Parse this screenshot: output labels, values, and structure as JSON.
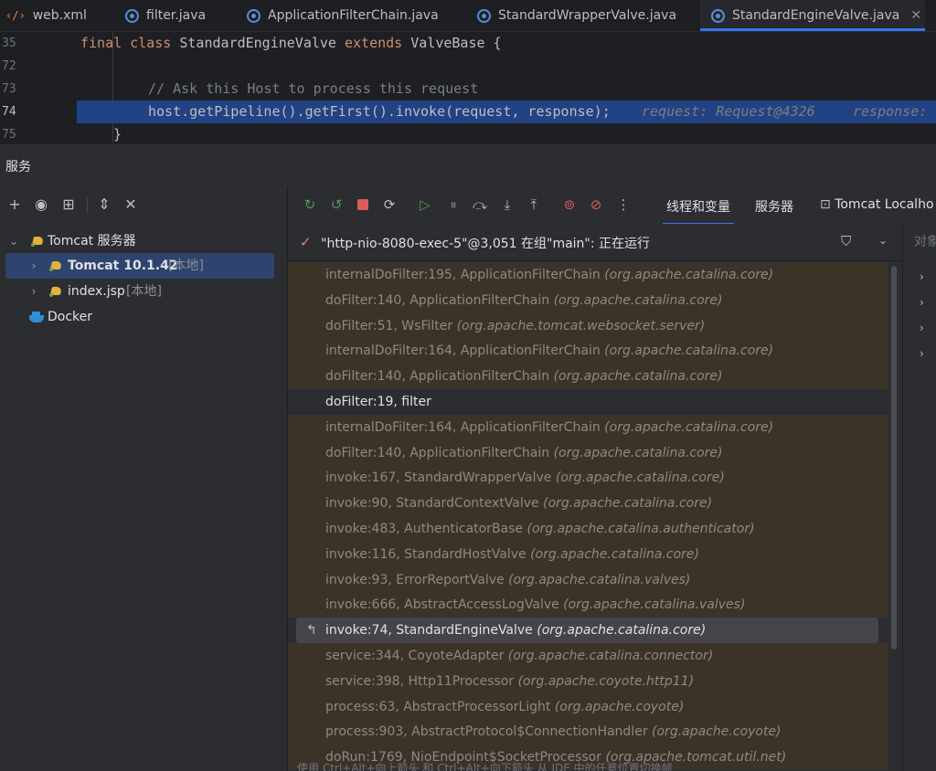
{
  "tabs": [
    {
      "label": "web.xml",
      "icon": "xml-file-icon"
    },
    {
      "label": "filter.java",
      "icon": "java-class-icon"
    },
    {
      "label": "ApplicationFilterChain.java",
      "icon": "java-class-icon"
    },
    {
      "label": "StandardWrapperValve.java",
      "icon": "java-class-icon"
    },
    {
      "label": "StandardEngineValve.java",
      "icon": "java-class-icon",
      "active": true
    }
  ],
  "editor": {
    "lines": [
      {
        "num": "35",
        "kw1": "final class ",
        "text": "StandardEngineValve ",
        "kw2": "extends ",
        "text2": "ValveBase {"
      },
      {
        "num": "72",
        "text": ""
      },
      {
        "num": "73",
        "comment": "// Ask this Host to process this request"
      },
      {
        "num": "74",
        "text": "host.getPipeline().getFirst().invoke(request, response);",
        "hint1": "request: Request@4326",
        "hint2": "response: "
      },
      {
        "num": "75",
        "text": "}"
      }
    ]
  },
  "services": {
    "title": "服务",
    "tree": [
      {
        "label": "Tomcat 服务器",
        "expanded": true
      },
      {
        "label": "Tomcat 10.1.42",
        "suffix": "[本地]",
        "selected": true
      },
      {
        "label": "index.jsp",
        "suffix": "[本地]"
      },
      {
        "label": "Docker"
      }
    ]
  },
  "debugger": {
    "tabs": [
      "线程和变量",
      "服务器",
      "Tomcat Localho"
    ],
    "thread": "\"http-nio-8080-exec-5\"@3,051 在组\"main\": 正在运行",
    "vars_title": "对象",
    "frames": [
      {
        "method": "internalDoFilter:195, ApplicationFilterChain",
        "pkg": "(org.apache.catalina.core)",
        "kind": "lib"
      },
      {
        "method": "doFilter:140, ApplicationFilterChain",
        "pkg": "(org.apache.catalina.core)",
        "kind": "lib"
      },
      {
        "method": "doFilter:51, WsFilter",
        "pkg": "(org.apache.tomcat.websocket.server)",
        "kind": "lib"
      },
      {
        "method": "internalDoFilter:164, ApplicationFilterChain",
        "pkg": "(org.apache.catalina.core)",
        "kind": "lib"
      },
      {
        "method": "doFilter:140, ApplicationFilterChain",
        "pkg": "(org.apache.catalina.core)",
        "kind": "lib"
      },
      {
        "method": "doFilter:19, filter",
        "pkg": "",
        "kind": "user"
      },
      {
        "method": "internalDoFilter:164, ApplicationFilterChain",
        "pkg": "(org.apache.catalina.core)",
        "kind": "lib"
      },
      {
        "method": "doFilter:140, ApplicationFilterChain",
        "pkg": "(org.apache.catalina.core)",
        "kind": "lib"
      },
      {
        "method": "invoke:167, StandardWrapperValve",
        "pkg": "(org.apache.catalina.core)",
        "kind": "lib"
      },
      {
        "method": "invoke:90, StandardContextValve",
        "pkg": "(org.apache.catalina.core)",
        "kind": "lib"
      },
      {
        "method": "invoke:483, AuthenticatorBase",
        "pkg": "(org.apache.catalina.authenticator)",
        "kind": "lib"
      },
      {
        "method": "invoke:116, StandardHostValve",
        "pkg": "(org.apache.catalina.core)",
        "kind": "lib"
      },
      {
        "method": "invoke:93, ErrorReportValve",
        "pkg": "(org.apache.catalina.valves)",
        "kind": "lib"
      },
      {
        "method": "invoke:666, AbstractAccessLogValve",
        "pkg": "(org.apache.catalina.valves)",
        "kind": "lib"
      },
      {
        "method": "invoke:74, StandardEngineValve",
        "pkg": "(org.apache.catalina.core)",
        "kind": "cur"
      },
      {
        "method": "service:344, CoyoteAdapter",
        "pkg": "(org.apache.catalina.connector)",
        "kind": "lib"
      },
      {
        "method": "service:398, Http11Processor",
        "pkg": "(org.apache.coyote.http11)",
        "kind": "lib"
      },
      {
        "method": "process:63, AbstractProcessorLight",
        "pkg": "(org.apache.coyote)",
        "kind": "lib"
      },
      {
        "method": "process:903, AbstractProtocol$ConnectionHandler",
        "pkg": "(org.apache.coyote)",
        "kind": "lib"
      },
      {
        "method": "doRun:1769, NioEndpoint$SocketProcessor",
        "pkg": "(org.apache.tomcat.util.net)",
        "kind": "lib"
      }
    ],
    "status": "使用 Ctrl+Alt+向上箭头 和 Ctrl+Alt+向下箭头 从 IDE 中的任意位置切换帧"
  },
  "colors": {
    "accent": "#3574f0",
    "selection": "#2e436e",
    "library_frame": "#3c3328",
    "editor_highlight": "#214283"
  }
}
